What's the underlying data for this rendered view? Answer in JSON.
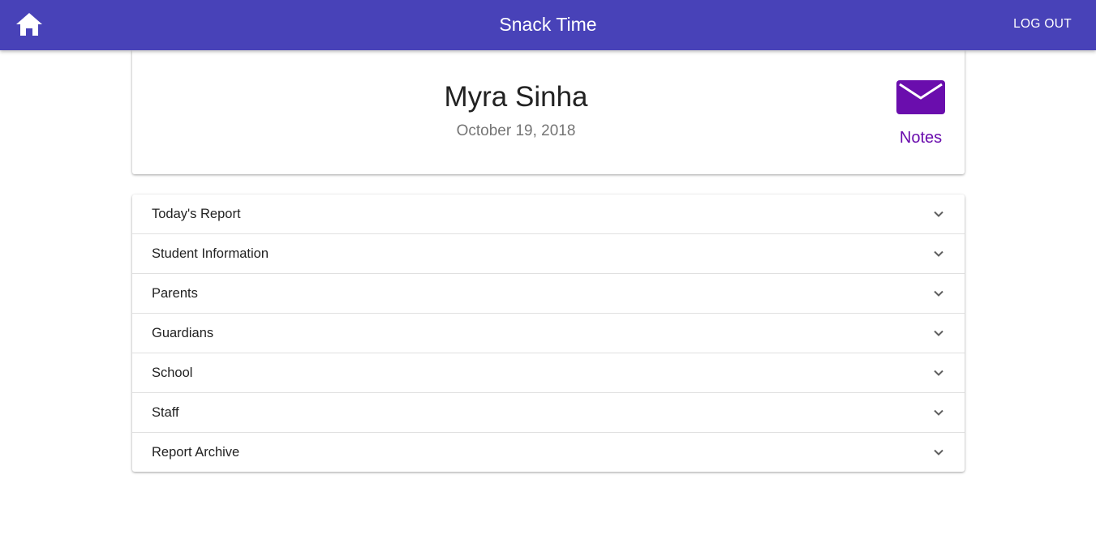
{
  "appbar": {
    "home_icon": "home-icon",
    "title": "Snack Time",
    "logout_label": "LOG OUT",
    "background_color": "#4842b8"
  },
  "profile": {
    "name": "Myra Sinha",
    "date": "October 19, 2018",
    "notes": {
      "icon": "envelope-icon",
      "label": "Notes",
      "color": "#6a0dad"
    }
  },
  "sections": [
    {
      "label": "Today's Report",
      "icon": "chevron-down-icon"
    },
    {
      "label": "Student Information",
      "icon": "chevron-down-icon"
    },
    {
      "label": "Parents",
      "icon": "chevron-down-icon"
    },
    {
      "label": "Guardians",
      "icon": "chevron-down-icon"
    },
    {
      "label": "School",
      "icon": "chevron-down-icon"
    },
    {
      "label": "Staff",
      "icon": "chevron-down-icon"
    },
    {
      "label": "Report Archive",
      "icon": "chevron-down-icon"
    }
  ]
}
